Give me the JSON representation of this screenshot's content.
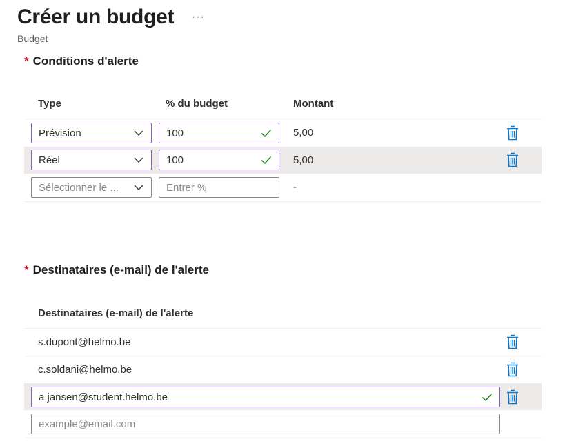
{
  "header": {
    "title": "Créer un budget",
    "more_label": "···",
    "subtitle": "Budget"
  },
  "alert_conditions": {
    "title": "Conditions d'alerte",
    "required_mark": "*",
    "columns": {
      "type": "Type",
      "percent": "% du budget",
      "amount": "Montant"
    },
    "rows": [
      {
        "type": "Prévision",
        "percent": "100",
        "amount": "5,00"
      },
      {
        "type": "Réel",
        "percent": "100",
        "amount": "5,00"
      }
    ],
    "new_row": {
      "type_placeholder": "Sélectionner le ...",
      "percent_placeholder": "Entrer %",
      "amount": "-"
    }
  },
  "alert_recipients": {
    "title": "Destinataires (e-mail) de l'alerte",
    "required_mark": "*",
    "column": "Destinataires (e-mail) de l'alerte",
    "emails": [
      "s.dupont@helmo.be",
      "c.soldani@helmo.be"
    ],
    "editing_email": "a.jansen@student.helmo.be",
    "new_email_placeholder": "example@email.com"
  },
  "icons": {
    "trash": "trash-icon",
    "chevron": "chevron-down-icon",
    "check": "checkmark-icon",
    "more": "more-icon"
  },
  "colors": {
    "accent_border": "#8764b8",
    "trash": "#0078d4",
    "check": "#107c10",
    "required": "#c50f1f"
  }
}
